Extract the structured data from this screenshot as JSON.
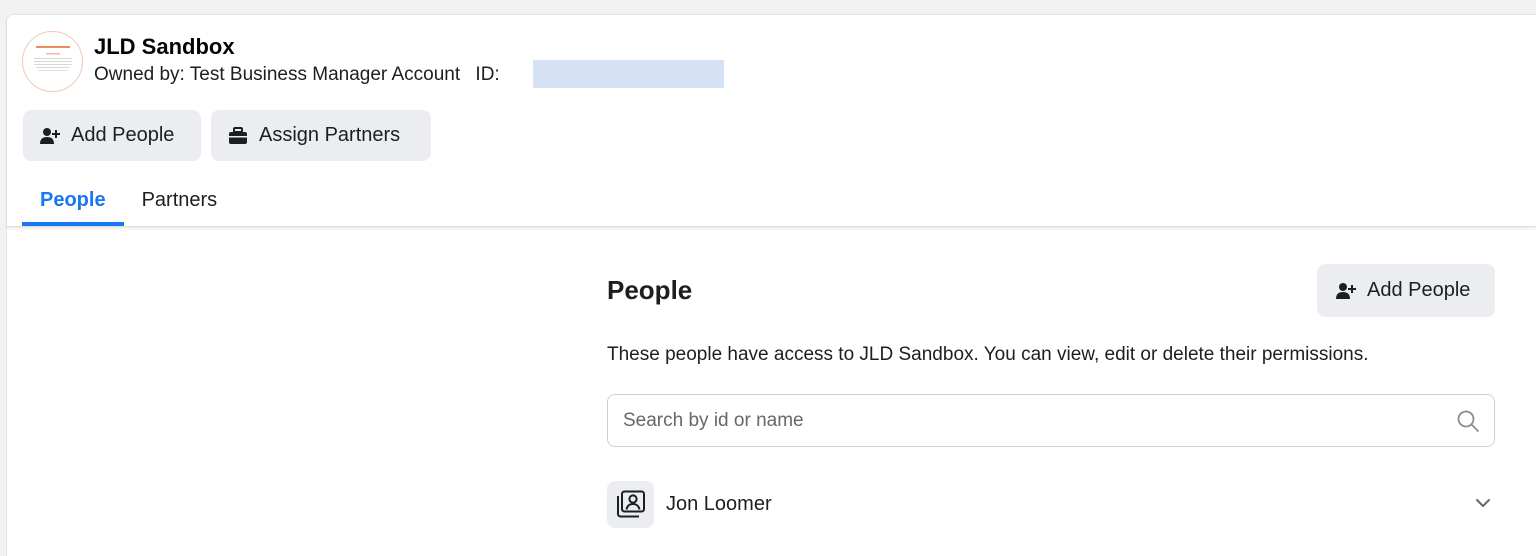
{
  "account": {
    "name": "JLD Sandbox",
    "owned_by_label": "Owned by:",
    "owner": "Test Business Manager Account",
    "id_label": "ID:",
    "avatar_icon": "page-profile-image"
  },
  "toolbar": {
    "add_people_label": "Add People",
    "add_people_icon": "add-person-icon",
    "assign_partners_label": "Assign Partners",
    "assign_partners_icon": "briefcase-icon"
  },
  "tabs": [
    {
      "label": "People",
      "active": true
    },
    {
      "label": "Partners",
      "active": false
    }
  ],
  "main": {
    "title": "People",
    "add_people_label": "Add People",
    "description": "These people have access to JLD Sandbox. You can view, edit or delete their permissions.",
    "search": {
      "placeholder": "Search by id or name",
      "value": "",
      "icon": "search-icon"
    },
    "people": [
      {
        "name": "Jon Loomer",
        "icon": "person-card-icon"
      }
    ]
  },
  "colors": {
    "accent": "#1877f2",
    "button_bg": "#ebedf0",
    "redaction": "#d5e2f6"
  }
}
